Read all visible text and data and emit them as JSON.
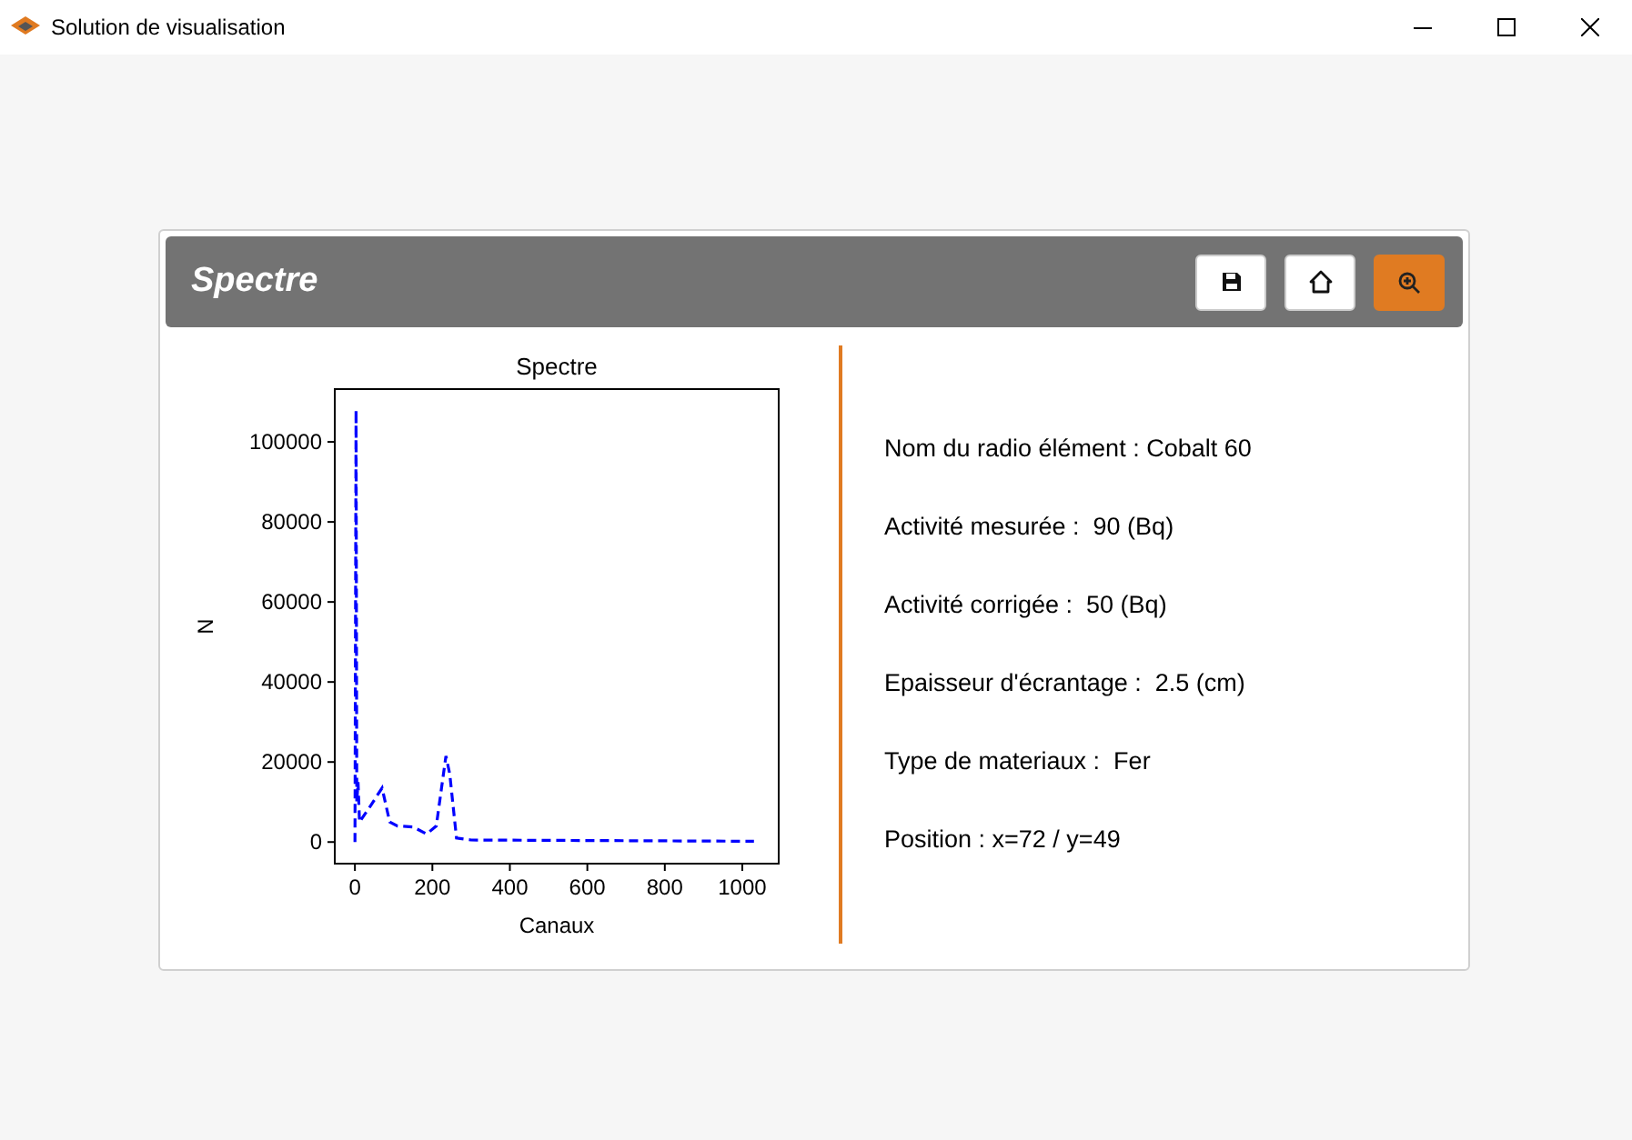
{
  "window": {
    "title": "Solution de visualisation"
  },
  "panel": {
    "title": "Spectre",
    "buttons": [
      {
        "kind": "save",
        "selected": false
      },
      {
        "kind": "home",
        "selected": false
      },
      {
        "kind": "zoom",
        "selected": true
      }
    ]
  },
  "chart_data": {
    "type": "line",
    "title": "Spectre",
    "xlabel": "Canaux",
    "ylabel": "N",
    "xlim": [
      -52,
      1094
    ],
    "ylim": [
      -5400,
      113200
    ],
    "xticks": [
      0,
      200,
      400,
      600,
      800,
      1000
    ],
    "yticks": [
      0,
      20000,
      40000,
      60000,
      80000,
      100000
    ],
    "x": [
      0,
      3,
      5,
      8,
      12,
      40,
      70,
      90,
      110,
      150,
      185,
      210,
      235,
      245,
      262,
      300,
      1030
    ],
    "series": [
      {
        "color": "#0000ff",
        "line_style": "dashed",
        "values": [
          0,
          108000,
          10000,
          15000,
          5000,
          9000,
          13500,
          5000,
          4000,
          3800,
          2000,
          4000,
          21500,
          17000,
          1000,
          500,
          200
        ]
      }
    ]
  },
  "info": [
    "Nom du radio élément : Cobalt 60",
    "Activité mesurée :  90 (Bq)",
    "Activité corrigée :  50 (Bq)",
    "Epaisseur d'écrantage :  2.5 (cm)",
    "Type de materiaux :  Fer",
    "Position : x=72 / y=49"
  ]
}
